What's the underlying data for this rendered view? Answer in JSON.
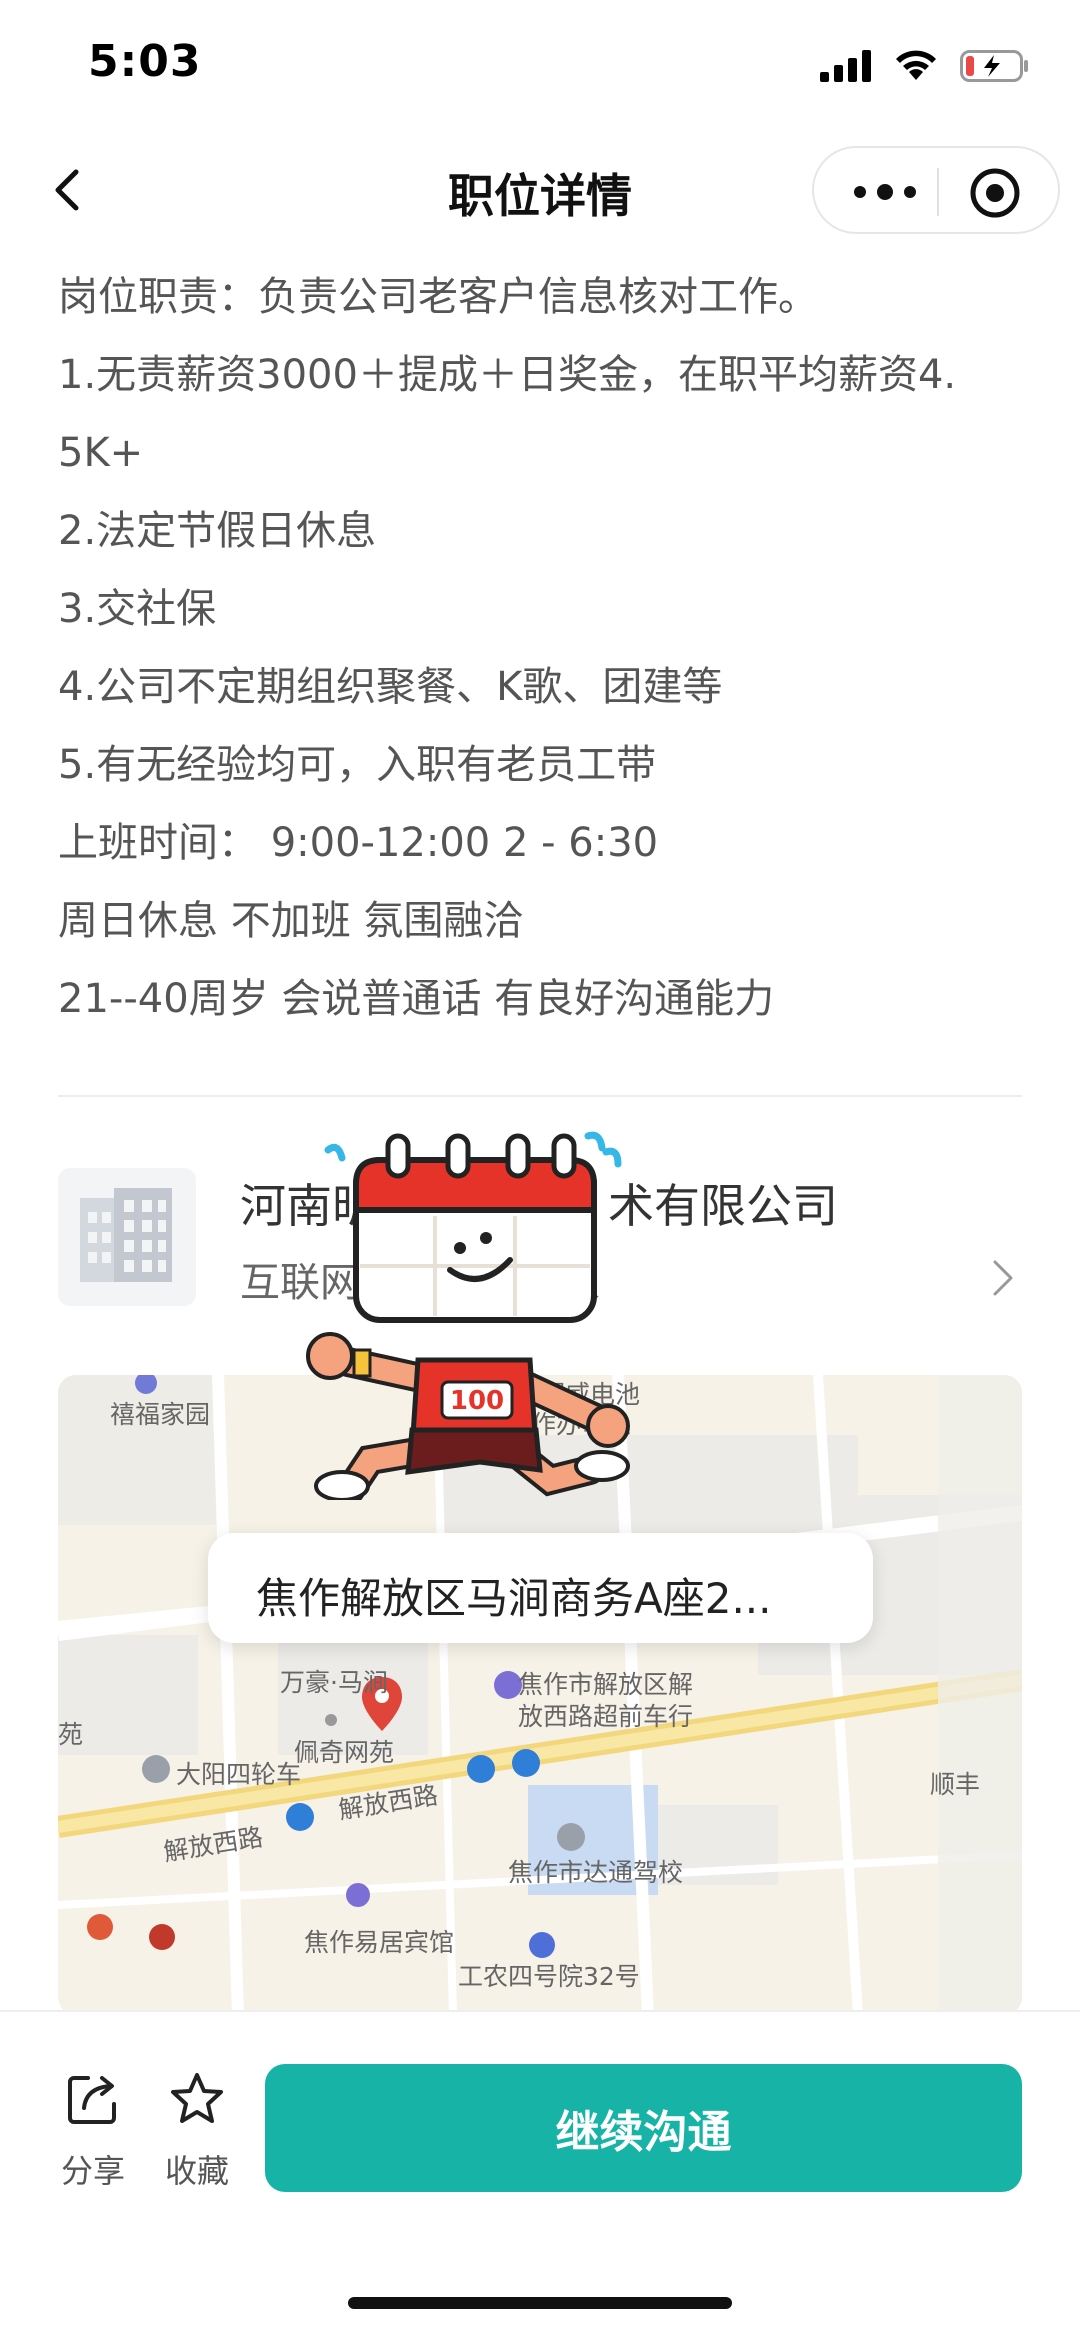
{
  "status_bar": {
    "time": "5:03"
  },
  "nav": {
    "title": "职位详情"
  },
  "description": {
    "lines": [
      "岗位职责：负责公司老客户信息核对工作。",
      "1.无责薪资3000＋提成＋日奖金，在职平均薪资4.",
      "5K+",
      "2.法定节假日休息",
      "3.交社保",
      "4.公司不定期组织聚餐、K歌、团建等",
      "5.有无经验均可，入职有老员工带",
      "上班时间：  9:00-12:00 2 - 6:30",
      "周日休息 不加班 氛围融洽",
      "21--40周岁 会说普通话 有良好沟通能力"
    ]
  },
  "company": {
    "name": "河南昕　　　　　术有限公司",
    "meta": "互联网　　　　　人"
  },
  "map": {
    "address": "焦作解放区马涧商务A座2...",
    "labels": {
      "l1": "禧福家园",
      "l2": "超威电池",
      "l3": "焦作办事处",
      "l4": "万豪·马涧",
      "l5": "焦作市解放区解",
      "l6": "放西路超前车行",
      "l7": "大阳四轮车",
      "l8": "佩奇网苑",
      "l9": "解放西路",
      "l10": "解放西路",
      "l11": "顺丰",
      "l12": "焦作市达通驾校",
      "l13": "焦作易居宾馆",
      "l14": "工农四号院32号",
      "l15": "苑"
    }
  },
  "mascot": {
    "badge": "100"
  },
  "bottom": {
    "share_label": "分享",
    "favorite_label": "收藏",
    "primary_label": "继续沟通"
  },
  "colors": {
    "accent": "#17b3a7",
    "battery_low": "#e84a4a"
  },
  "icons": [
    "signal-icon",
    "wifi-icon",
    "battery-icon",
    "back-icon",
    "more-icon",
    "target-icon",
    "chevron-right-icon",
    "share-icon",
    "star-icon",
    "location-pin-icon"
  ]
}
